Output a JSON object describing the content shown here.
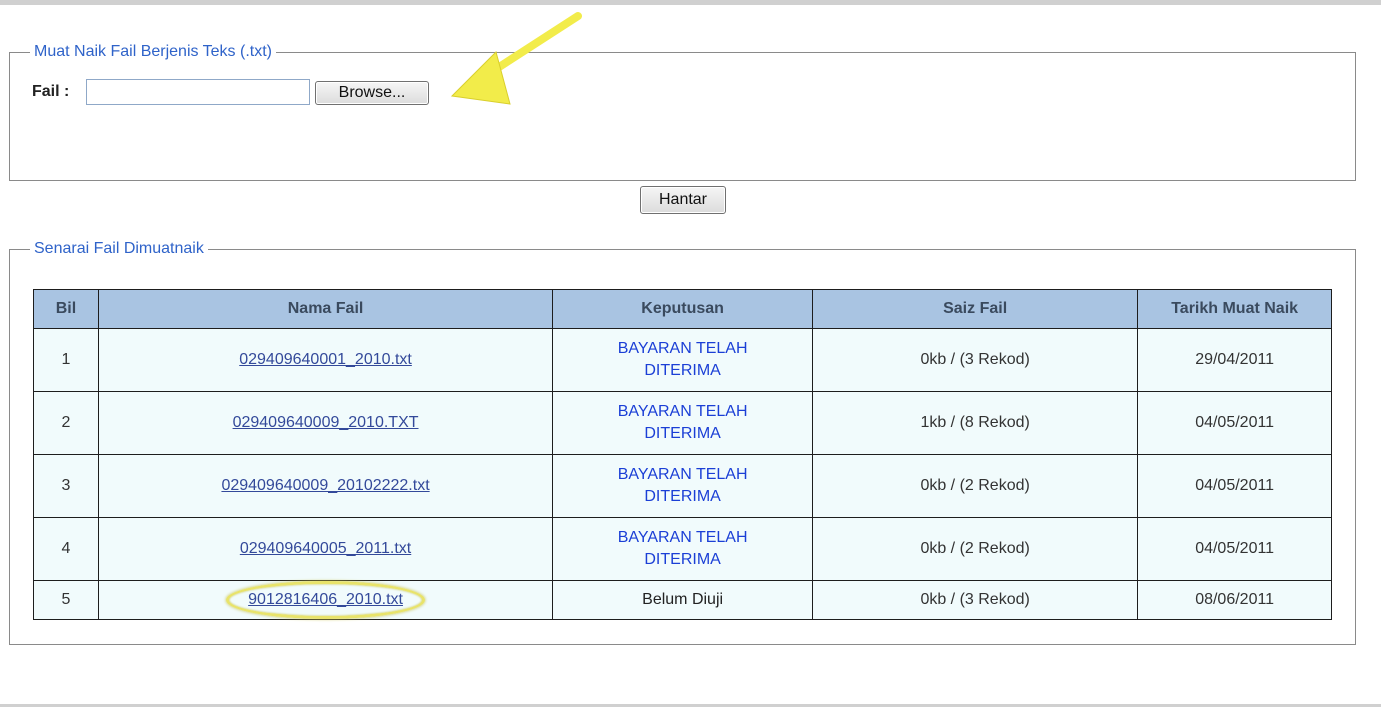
{
  "upload": {
    "legend": "Muat Naik Fail Berjenis Teks (.txt)",
    "file_label": "Fail :",
    "file_value": "",
    "browse_label": "Browse..."
  },
  "submit_label": "Hantar",
  "list": {
    "legend": "Senarai Fail Dimuatnaik",
    "columns": [
      "Bil",
      "Nama Fail",
      "Keputusan",
      "Saiz Fail",
      "Tarikh Muat Naik"
    ],
    "rows": [
      {
        "bil": "1",
        "nama": "029409640001_2010.txt",
        "keputusan": "BAYARAN TELAH DITERIMA",
        "saiz": "0kb / (3 Rekod)",
        "tarikh": "29/04/2011"
      },
      {
        "bil": "2",
        "nama": "029409640009_2010.TXT",
        "keputusan": "BAYARAN TELAH DITERIMA",
        "saiz": "1kb / (8 Rekod)",
        "tarikh": "04/05/2011"
      },
      {
        "bil": "3",
        "nama": "029409640009_20102222.txt",
        "keputusan": "BAYARAN TELAH DITERIMA",
        "saiz": "0kb / (2 Rekod)",
        "tarikh": "04/05/2011"
      },
      {
        "bil": "4",
        "nama": "029409640005_2011.txt",
        "keputusan": "BAYARAN TELAH DITERIMA",
        "saiz": "0kb / (2 Rekod)",
        "tarikh": "04/05/2011"
      },
      {
        "bil": "5",
        "nama": "9012816406_2010.txt",
        "keputusan": "Belum Diuji",
        "saiz": "0kb / (3 Rekod)",
        "tarikh": "08/06/2011"
      }
    ]
  },
  "colors": {
    "legend": "#2f63c9",
    "header_bg": "#a9c4e2",
    "cell_bg": "#f1fbfc",
    "status_paid": "#1b3fd6",
    "link": "#33499a",
    "annotation": "#e8e36a"
  },
  "icons": [
    "annotation-arrow-icon",
    "annotation-circle-highlight"
  ]
}
